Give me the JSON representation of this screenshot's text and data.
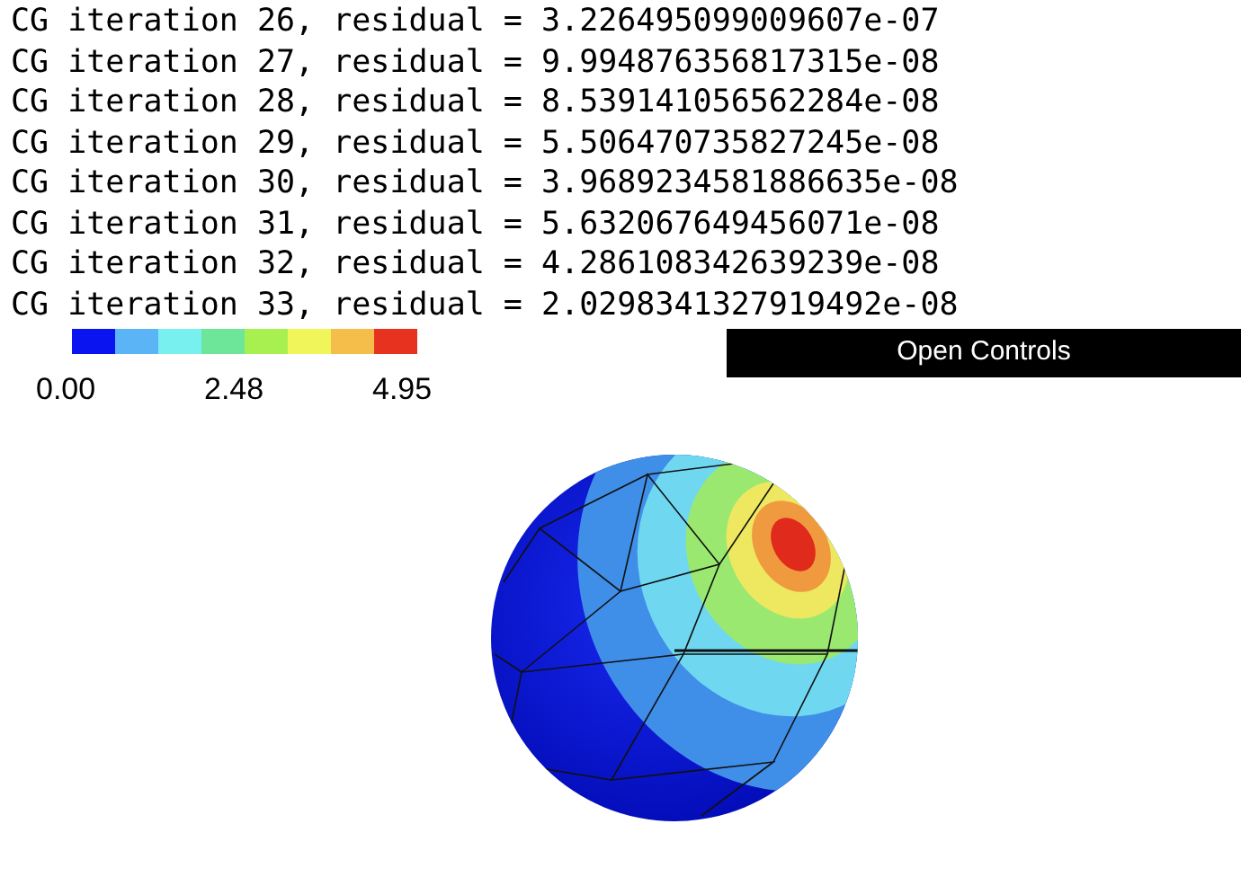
{
  "log_lines": [
    "CG iteration 26, residual = 3.226495099009607e-07",
    "CG iteration 27, residual = 9.994876356817315e-08",
    "CG iteration 28, residual = 8.539141056562284e-08",
    "CG iteration 29, residual = 5.506470735827245e-08",
    "CG iteration 30, residual = 3.9689234581886635e-08",
    "CG iteration 31, residual = 5.632067649456071e-08",
    "CG iteration 32, residual = 4.286108342639239e-08",
    "CG iteration 33, residual = 2.0298341327919492e-08"
  ],
  "colorbar": {
    "segments": [
      {
        "color": "#0a14f0"
      },
      {
        "color": "#5ab4f5"
      },
      {
        "color": "#78f0f0"
      },
      {
        "color": "#6ee69a"
      },
      {
        "color": "#a8f050"
      },
      {
        "color": "#f0f55a"
      },
      {
        "color": "#f5be4b"
      },
      {
        "color": "#e6321e"
      }
    ],
    "ticks": [
      "0.00",
      "2.48",
      "4.95"
    ]
  },
  "open_controls_button": "Open Controls"
}
